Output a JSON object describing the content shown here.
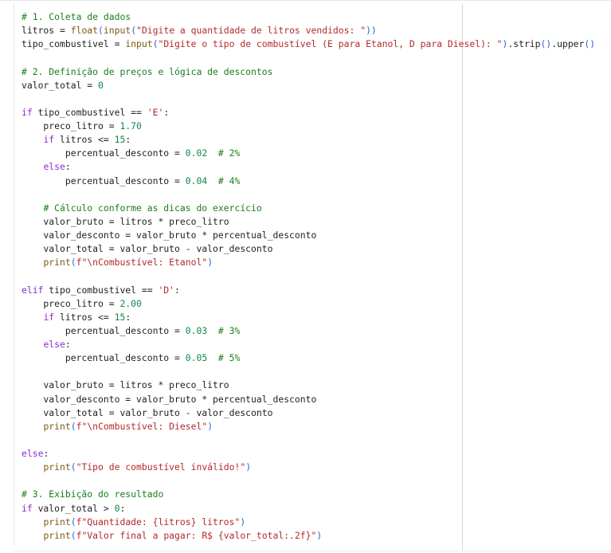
{
  "editor": {
    "lines": [
      {
        "tokens": [
          {
            "text": "# 1. Coleta de dados",
            "type": "comment"
          }
        ]
      },
      {
        "tokens": [
          {
            "text": "litros",
            "type": "name"
          },
          {
            "text": " = ",
            "type": "op"
          },
          {
            "text": "float",
            "type": "builtin"
          },
          {
            "text": "(",
            "type": "bracket"
          },
          {
            "text": "input",
            "type": "builtin"
          },
          {
            "text": "(",
            "type": "bracket"
          },
          {
            "text": "\"Digite a quantidade de litros vendidos: \"",
            "type": "string"
          },
          {
            "text": "))",
            "type": "bracket"
          }
        ]
      },
      {
        "tokens": [
          {
            "text": "tipo_combustivel",
            "type": "name"
          },
          {
            "text": " = ",
            "type": "op"
          },
          {
            "text": "input",
            "type": "builtin"
          },
          {
            "text": "(",
            "type": "bracket"
          },
          {
            "text": "\"Digite o tipo de combustível (E para Etanol, D para Diesel): \"",
            "type": "string"
          },
          {
            "text": ")",
            "type": "bracket"
          },
          {
            "text": ".strip",
            "type": "name"
          },
          {
            "text": "()",
            "type": "bracket"
          },
          {
            "text": ".upper",
            "type": "name"
          },
          {
            "text": "()",
            "type": "bracket"
          }
        ]
      },
      {
        "tokens": []
      },
      {
        "tokens": [
          {
            "text": "# 2. Definição de preços e lógica de descontos",
            "type": "comment"
          }
        ]
      },
      {
        "tokens": [
          {
            "text": "valor_total",
            "type": "name"
          },
          {
            "text": " = ",
            "type": "op"
          },
          {
            "text": "0",
            "type": "number"
          }
        ]
      },
      {
        "tokens": []
      },
      {
        "tokens": [
          {
            "text": "if",
            "type": "keyword"
          },
          {
            "text": " tipo_combustivel == ",
            "type": "name"
          },
          {
            "text": "'E'",
            "type": "string"
          },
          {
            "text": ":",
            "type": "op"
          }
        ]
      },
      {
        "tokens": [
          {
            "text": "    preco_litro",
            "type": "name"
          },
          {
            "text": " = ",
            "type": "op"
          },
          {
            "text": "1.70",
            "type": "number"
          }
        ]
      },
      {
        "tokens": [
          {
            "text": "    ",
            "type": "name"
          },
          {
            "text": "if",
            "type": "keyword"
          },
          {
            "text": " litros <= ",
            "type": "name"
          },
          {
            "text": "15",
            "type": "number"
          },
          {
            "text": ":",
            "type": "op"
          }
        ]
      },
      {
        "tokens": [
          {
            "text": "        percentual_desconto",
            "type": "name"
          },
          {
            "text": " = ",
            "type": "op"
          },
          {
            "text": "0.02",
            "type": "number"
          },
          {
            "text": "  ",
            "type": "op"
          },
          {
            "text": "# 2%",
            "type": "comment"
          }
        ]
      },
      {
        "tokens": [
          {
            "text": "    ",
            "type": "name"
          },
          {
            "text": "else",
            "type": "keyword"
          },
          {
            "text": ":",
            "type": "op"
          }
        ]
      },
      {
        "tokens": [
          {
            "text": "        percentual_desconto",
            "type": "name"
          },
          {
            "text": " = ",
            "type": "op"
          },
          {
            "text": "0.04",
            "type": "number"
          },
          {
            "text": "  ",
            "type": "op"
          },
          {
            "text": "# 4%",
            "type": "comment"
          }
        ]
      },
      {
        "tokens": []
      },
      {
        "tokens": [
          {
            "text": "    ",
            "type": "name"
          },
          {
            "text": "# Cálculo conforme as dicas do exercício",
            "type": "comment"
          }
        ]
      },
      {
        "tokens": [
          {
            "text": "    valor_bruto",
            "type": "name"
          },
          {
            "text": " = ",
            "type": "op"
          },
          {
            "text": "litros * preco_litro",
            "type": "name"
          }
        ]
      },
      {
        "tokens": [
          {
            "text": "    valor_desconto",
            "type": "name"
          },
          {
            "text": " = ",
            "type": "op"
          },
          {
            "text": "valor_bruto * percentual_desconto",
            "type": "name"
          }
        ]
      },
      {
        "tokens": [
          {
            "text": "    valor_total",
            "type": "name"
          },
          {
            "text": " = ",
            "type": "op"
          },
          {
            "text": "valor_bruto - valor_desconto",
            "type": "name"
          }
        ]
      },
      {
        "tokens": [
          {
            "text": "    ",
            "type": "name"
          },
          {
            "text": "print",
            "type": "builtin"
          },
          {
            "text": "(",
            "type": "bracket"
          },
          {
            "text": "f\"\\nCombustível: Etanol\"",
            "type": "string"
          },
          {
            "text": ")",
            "type": "bracket"
          }
        ]
      },
      {
        "tokens": []
      },
      {
        "tokens": [
          {
            "text": "elif",
            "type": "keyword"
          },
          {
            "text": " tipo_combustivel == ",
            "type": "name"
          },
          {
            "text": "'D'",
            "type": "string"
          },
          {
            "text": ":",
            "type": "op"
          }
        ]
      },
      {
        "tokens": [
          {
            "text": "    preco_litro",
            "type": "name"
          },
          {
            "text": " = ",
            "type": "op"
          },
          {
            "text": "2.00",
            "type": "number"
          }
        ]
      },
      {
        "tokens": [
          {
            "text": "    ",
            "type": "name"
          },
          {
            "text": "if",
            "type": "keyword"
          },
          {
            "text": " litros <= ",
            "type": "name"
          },
          {
            "text": "15",
            "type": "number"
          },
          {
            "text": ":",
            "type": "op"
          }
        ]
      },
      {
        "tokens": [
          {
            "text": "        percentual_desconto",
            "type": "name"
          },
          {
            "text": " = ",
            "type": "op"
          },
          {
            "text": "0.03",
            "type": "number"
          },
          {
            "text": "  ",
            "type": "op"
          },
          {
            "text": "# 3%",
            "type": "comment"
          }
        ]
      },
      {
        "tokens": [
          {
            "text": "    ",
            "type": "name"
          },
          {
            "text": "else",
            "type": "keyword"
          },
          {
            "text": ":",
            "type": "op"
          }
        ]
      },
      {
        "tokens": [
          {
            "text": "        percentual_desconto",
            "type": "name"
          },
          {
            "text": " = ",
            "type": "op"
          },
          {
            "text": "0.05",
            "type": "number"
          },
          {
            "text": "  ",
            "type": "op"
          },
          {
            "text": "# 5%",
            "type": "comment"
          }
        ]
      },
      {
        "tokens": []
      },
      {
        "tokens": [
          {
            "text": "    valor_bruto",
            "type": "name"
          },
          {
            "text": " = ",
            "type": "op"
          },
          {
            "text": "litros * preco_litro",
            "type": "name"
          }
        ]
      },
      {
        "tokens": [
          {
            "text": "    valor_desconto",
            "type": "name"
          },
          {
            "text": " = ",
            "type": "op"
          },
          {
            "text": "valor_bruto * percentual_desconto",
            "type": "name"
          }
        ]
      },
      {
        "tokens": [
          {
            "text": "    valor_total",
            "type": "name"
          },
          {
            "text": " = ",
            "type": "op"
          },
          {
            "text": "valor_bruto - valor_desconto",
            "type": "name"
          }
        ]
      },
      {
        "tokens": [
          {
            "text": "    ",
            "type": "name"
          },
          {
            "text": "print",
            "type": "builtin"
          },
          {
            "text": "(",
            "type": "bracket"
          },
          {
            "text": "f\"\\nCombustível: Diesel\"",
            "type": "string"
          },
          {
            "text": ")",
            "type": "bracket"
          }
        ]
      },
      {
        "tokens": []
      },
      {
        "tokens": [
          {
            "text": "else",
            "type": "keyword"
          },
          {
            "text": ":",
            "type": "op"
          }
        ]
      },
      {
        "tokens": [
          {
            "text": "    ",
            "type": "name"
          },
          {
            "text": "print",
            "type": "builtin"
          },
          {
            "text": "(",
            "type": "bracket"
          },
          {
            "text": "\"Tipo de combustível inválido!\"",
            "type": "string"
          },
          {
            "text": ")",
            "type": "bracket"
          }
        ]
      },
      {
        "tokens": []
      },
      {
        "tokens": [
          {
            "text": "# 3. Exibição do resultado",
            "type": "comment"
          }
        ]
      },
      {
        "tokens": [
          {
            "text": "if",
            "type": "keyword"
          },
          {
            "text": " valor_total > ",
            "type": "name"
          },
          {
            "text": "0",
            "type": "number"
          },
          {
            "text": ":",
            "type": "op"
          }
        ]
      },
      {
        "tokens": [
          {
            "text": "    ",
            "type": "name"
          },
          {
            "text": "print",
            "type": "builtin"
          },
          {
            "text": "(",
            "type": "bracket"
          },
          {
            "text": "f\"Quantidade: {litros} litros\"",
            "type": "string"
          },
          {
            "text": ")",
            "type": "bracket"
          }
        ]
      },
      {
        "tokens": [
          {
            "text": "    ",
            "type": "name"
          },
          {
            "text": "print",
            "type": "builtin"
          },
          {
            "text": "(",
            "type": "bracket"
          },
          {
            "text": "f\"Valor final a pagar: R$ {valor_total:.2f}\"",
            "type": "string"
          },
          {
            "text": ")",
            "type": "bracket"
          }
        ]
      }
    ]
  },
  "theme": {
    "background": "#ffffff",
    "comment": "#1b7d1b",
    "keyword": "#8a2ad0",
    "builtin": "#7a5a11",
    "string": "#b12a2a",
    "number": "#0b8a4a",
    "name": "#1f1f1f",
    "bracket": "#2e63d2",
    "ruler": "#d7d7d7"
  }
}
